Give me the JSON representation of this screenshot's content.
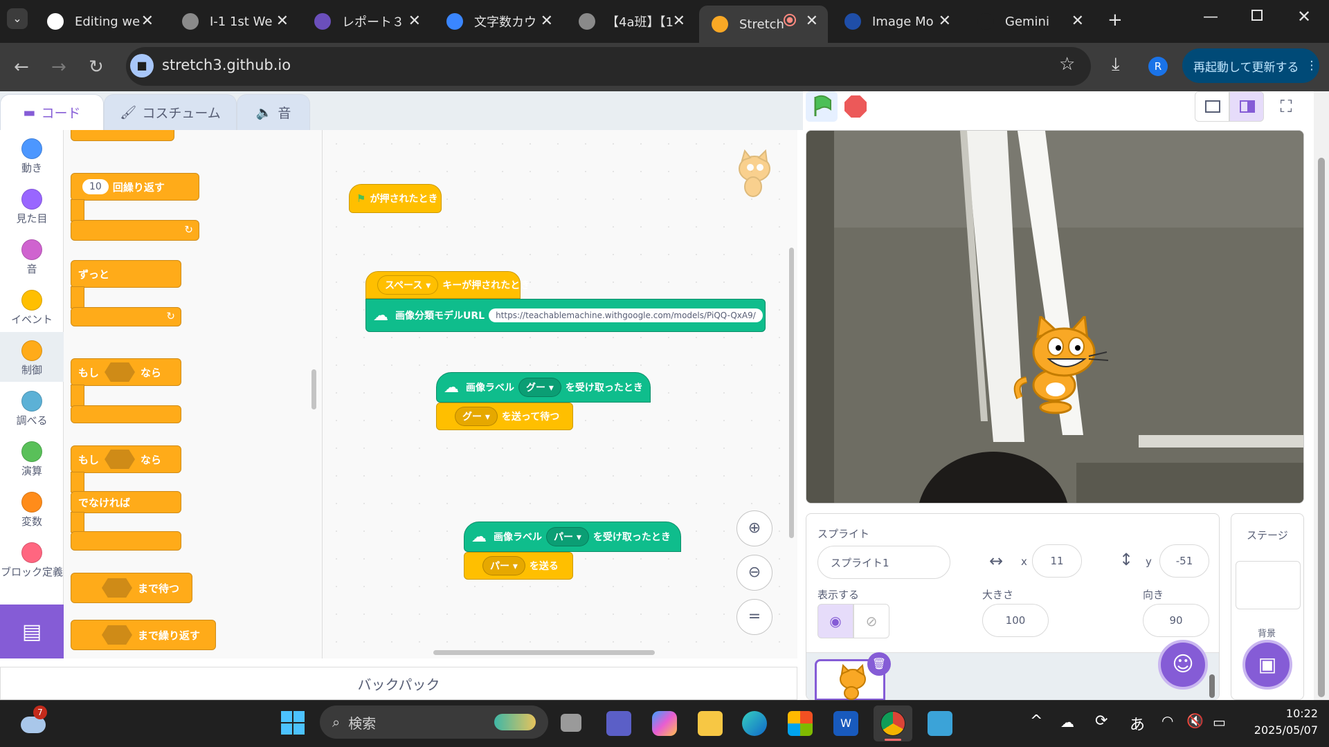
{
  "browser": {
    "tabs": [
      {
        "title": "Editing we",
        "icon": "github-icon"
      },
      {
        "title": "I-1 1st We",
        "icon": "globe-icon"
      },
      {
        "title": "レポート３",
        "icon": "list-icon"
      },
      {
        "title": "文字数カウ",
        "icon": "counter-icon"
      },
      {
        "title": "【4a班】【1",
        "icon": "portrait-icon"
      },
      {
        "title": "Stretch",
        "icon": "scratch-cat-icon"
      },
      {
        "title": "Image Mo",
        "icon": "tm-icon"
      },
      {
        "title": "Gemini",
        "icon": "gemini-icon"
      }
    ],
    "url": "stretch3.github.io",
    "update_button": "再起動して更新する",
    "profile_initial": "R"
  },
  "editor": {
    "tabs": {
      "code": "コード",
      "costume": "コスチューム",
      "sound": "音"
    },
    "categories": [
      {
        "label": "動き",
        "color": "#4c97ff"
      },
      {
        "label": "見た目",
        "color": "#9966ff"
      },
      {
        "label": "音",
        "color": "#cf63cf"
      },
      {
        "label": "イベント",
        "color": "#ffbf00"
      },
      {
        "label": "制御",
        "color": "#ffab19"
      },
      {
        "label": "調べる",
        "color": "#5cb1d6"
      },
      {
        "label": "演算",
        "color": "#59c059"
      },
      {
        "label": "変数",
        "color": "#ff8c1a"
      },
      {
        "label": "ブロック定義",
        "color": "#ff6680"
      }
    ],
    "palette": {
      "repeat_count": "10",
      "repeat": "回繰り返す",
      "forever": "ずっと",
      "if": "もし",
      "then": "なら",
      "else": "でなければ",
      "wait_until": "まで待つ",
      "repeat_until": "まで繰り返す"
    },
    "scripts": {
      "flag_hat": "が押されたとき",
      "key": "スペース",
      "key_hat": "キーが押されたとき",
      "model_url_label": "画像分類モデルURL",
      "model_url": "https://teachablemachine.withgoogle.com/models/PiQQ-QxA9/",
      "label_prefix": "画像ラベル",
      "label_goo": "グー",
      "label_paa": "パー",
      "received_suffix": "を受け取ったとき",
      "broadcast_wait": "を送って待つ",
      "broadcast": "を送る"
    },
    "backpack": "バックパック"
  },
  "sprite_info": {
    "heading": "スプライト",
    "name": "スプライト1",
    "x_label": "x",
    "x": "11",
    "y_label": "y",
    "y": "-51",
    "show_label": "表示する",
    "size_label": "大きさ",
    "size": "100",
    "direction_label": "向き",
    "direction": "90"
  },
  "stage_pane": {
    "heading": "ステージ",
    "backdrop_label": "背景"
  },
  "taskbar": {
    "search": "検索",
    "time": "10:22",
    "date": "2025/05/07",
    "ime": "あ",
    "weather_badge": "7"
  }
}
